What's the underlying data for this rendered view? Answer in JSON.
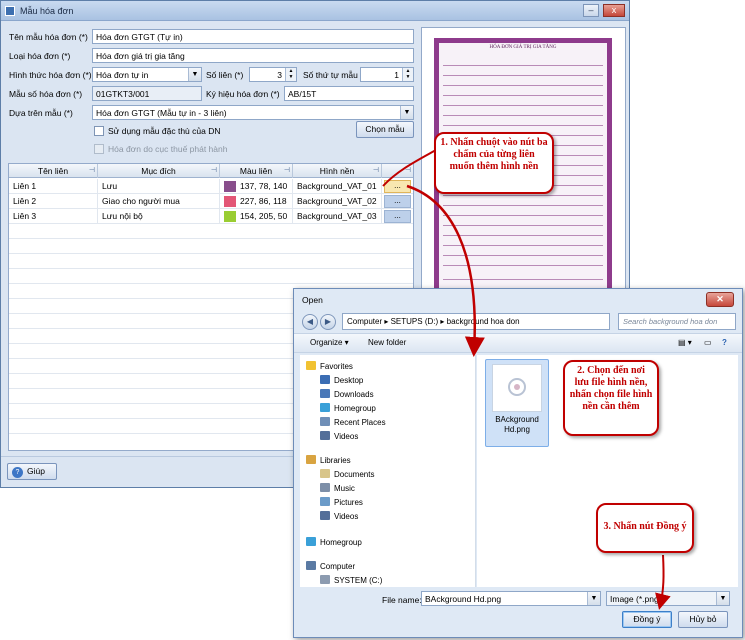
{
  "window": {
    "title": "Mẫu hóa đơn",
    "min_glyph": "–",
    "max_glyph": "□",
    "close_glyph": "x"
  },
  "form": {
    "ten_mau_label": "Tên mẫu hóa đơn (*)",
    "ten_mau_value": "Hóa đơn GTGT (Tự in)",
    "loai_label": "Loại hóa đơn (*)",
    "loai_value": "Hóa đơn giá trị gia tăng",
    "hinh_thuc_label": "Hình thức hóa đơn (*)",
    "hinh_thuc_value": "Hóa đơn tự in",
    "so_lien_label": "Số liên (*)",
    "so_lien_value": "3",
    "so_thu_tu_label": "Số thứ tự mẫu",
    "so_thu_tu_value": "1",
    "mau_so_label": "Mẫu số hóa đơn (*)",
    "mau_so_value": "01GTKT3/001",
    "ky_hieu_label": "Ký hiệu hóa đơn (*)",
    "ky_hieu_value": "AB/15T",
    "dua_tren_label": "Dựa trên mẫu (*)",
    "dua_tren_value": "Hóa đơn GTGT (Mẫu tự in - 3 liên)",
    "su_dung_label": "Sử dụng mẫu đặc thù của DN",
    "cuc_thue_label": "Hóa đơn do cục thuế phát hành",
    "chon_mau_button": "Chọn mẫu",
    "help_button": "Giúp"
  },
  "grid": {
    "headers": [
      "Tên liên",
      "Mục đích",
      "Màu liên",
      "Hình nền"
    ],
    "ellipsis": "...",
    "rows": [
      {
        "ten": "Liên 1",
        "muc_dich": "Lưu",
        "mau": "137, 78, 140",
        "color": "#894e8c",
        "hinh_nen": "Background_VAT_01"
      },
      {
        "ten": "Liên 2",
        "muc_dich": "Giao cho người mua",
        "mau": "227, 86, 118",
        "color": "#e35676",
        "hinh_nen": "Background_VAT_02"
      },
      {
        "ten": "Liên 3",
        "muc_dich": "Lưu nội bộ",
        "mau": "154, 205, 50",
        "color": "#9acd32",
        "hinh_nen": "Background_VAT_03"
      }
    ]
  },
  "preview": {
    "invoice_title": "HÓA ĐƠN GIÁ TRỊ GIA TĂNG"
  },
  "callouts": {
    "c1": "1. Nhấn chuột vào nút ba chấm của từng liên muốn thêm hình nền",
    "c2": "2. Chọn đến nơi lưu file hình nền, nhấn chọn file hình nền cần thêm",
    "c3": "3. Nhấn nút Đồng ý"
  },
  "open_dialog": {
    "title": "Open",
    "breadcrumb": [
      "Computer",
      "SETUPS (D:)",
      "background hoa don"
    ],
    "search_placeholder": "Search background hoa don",
    "organize": "Organize ▾",
    "new_folder": "New folder",
    "nav": {
      "favorites": "Favorites",
      "desktop": "Desktop",
      "downloads": "Downloads",
      "homegroup1": "Homegroup",
      "recent": "Recent Places",
      "videos1": "Videos",
      "libraries": "Libraries",
      "documents": "Documents",
      "music": "Music",
      "pictures": "Pictures",
      "videos2": "Videos",
      "homegroup2": "Homegroup",
      "computer": "Computer",
      "system": "SYSTEM (C:)"
    },
    "file_name_display": "BAckground Hd.png",
    "file_name_label": "File name:",
    "file_name_value": "BAckground Hd.png",
    "filter_value": "Image (*.png)",
    "ok_button": "Đồng ý",
    "cancel_button": "Hủy bỏ"
  },
  "colors": {
    "accent_red": "#c00000",
    "invoice_border": "#8e3b8c",
    "dialog_bg": "#dbe5f2"
  }
}
